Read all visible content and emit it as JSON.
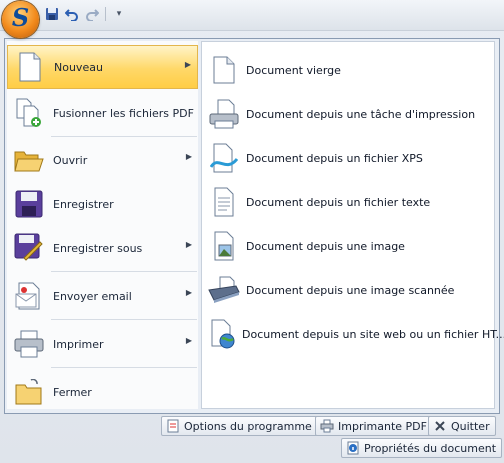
{
  "app": {
    "logo_letter": "S"
  },
  "quick_access": [
    {
      "icon": "save-icon"
    },
    {
      "icon": "undo-icon"
    },
    {
      "icon": "redo-icon"
    },
    {
      "icon": "customize-icon",
      "glyph": "▾"
    }
  ],
  "left_menu": {
    "items": [
      {
        "label": "Nouveau",
        "icon": "new-document-icon",
        "has_submenu": true,
        "selected": true
      },
      {
        "label": "Fusionner les fichiers PDF",
        "icon": "merge-pdf-icon",
        "has_submenu": false
      },
      {
        "label": "Ouvrir",
        "icon": "open-folder-icon",
        "has_submenu": true
      },
      {
        "label": "Enregistrer",
        "icon": "save-disk-icon",
        "has_submenu": false
      },
      {
        "label": "Enregistrer sous",
        "icon": "save-as-icon",
        "has_submenu": true
      },
      {
        "label": "Envoyer email",
        "icon": "email-icon",
        "has_submenu": true
      },
      {
        "label": "Imprimer",
        "icon": "printer-icon",
        "has_submenu": true
      },
      {
        "label": "Fermer",
        "icon": "close-folder-icon",
        "has_submenu": false
      }
    ],
    "arrow_glyph": "▶"
  },
  "submenu": {
    "items": [
      {
        "label": "Document vierge",
        "icon": "blank-document-icon"
      },
      {
        "label": "Document depuis une tâche d'impression",
        "icon": "print-job-icon"
      },
      {
        "label": "Document depuis un fichier XPS",
        "icon": "xps-file-icon"
      },
      {
        "label": "Document depuis un fichier texte",
        "icon": "text-file-icon"
      },
      {
        "label": "Document depuis une image",
        "icon": "image-file-icon"
      },
      {
        "label": "Document depuis une image scannée",
        "icon": "scanner-icon"
      },
      {
        "label": "Document depuis un site web ou un fichier HT...",
        "icon": "web-document-icon"
      }
    ]
  },
  "footer": {
    "options": "Options du programme",
    "printer": "Imprimante PDF",
    "quit": "Quitter",
    "properties": "Propriétés du document"
  },
  "colors": {
    "accent_selected": "#ffd868",
    "border": "#8a9bb2",
    "background": "#e9eef5"
  }
}
